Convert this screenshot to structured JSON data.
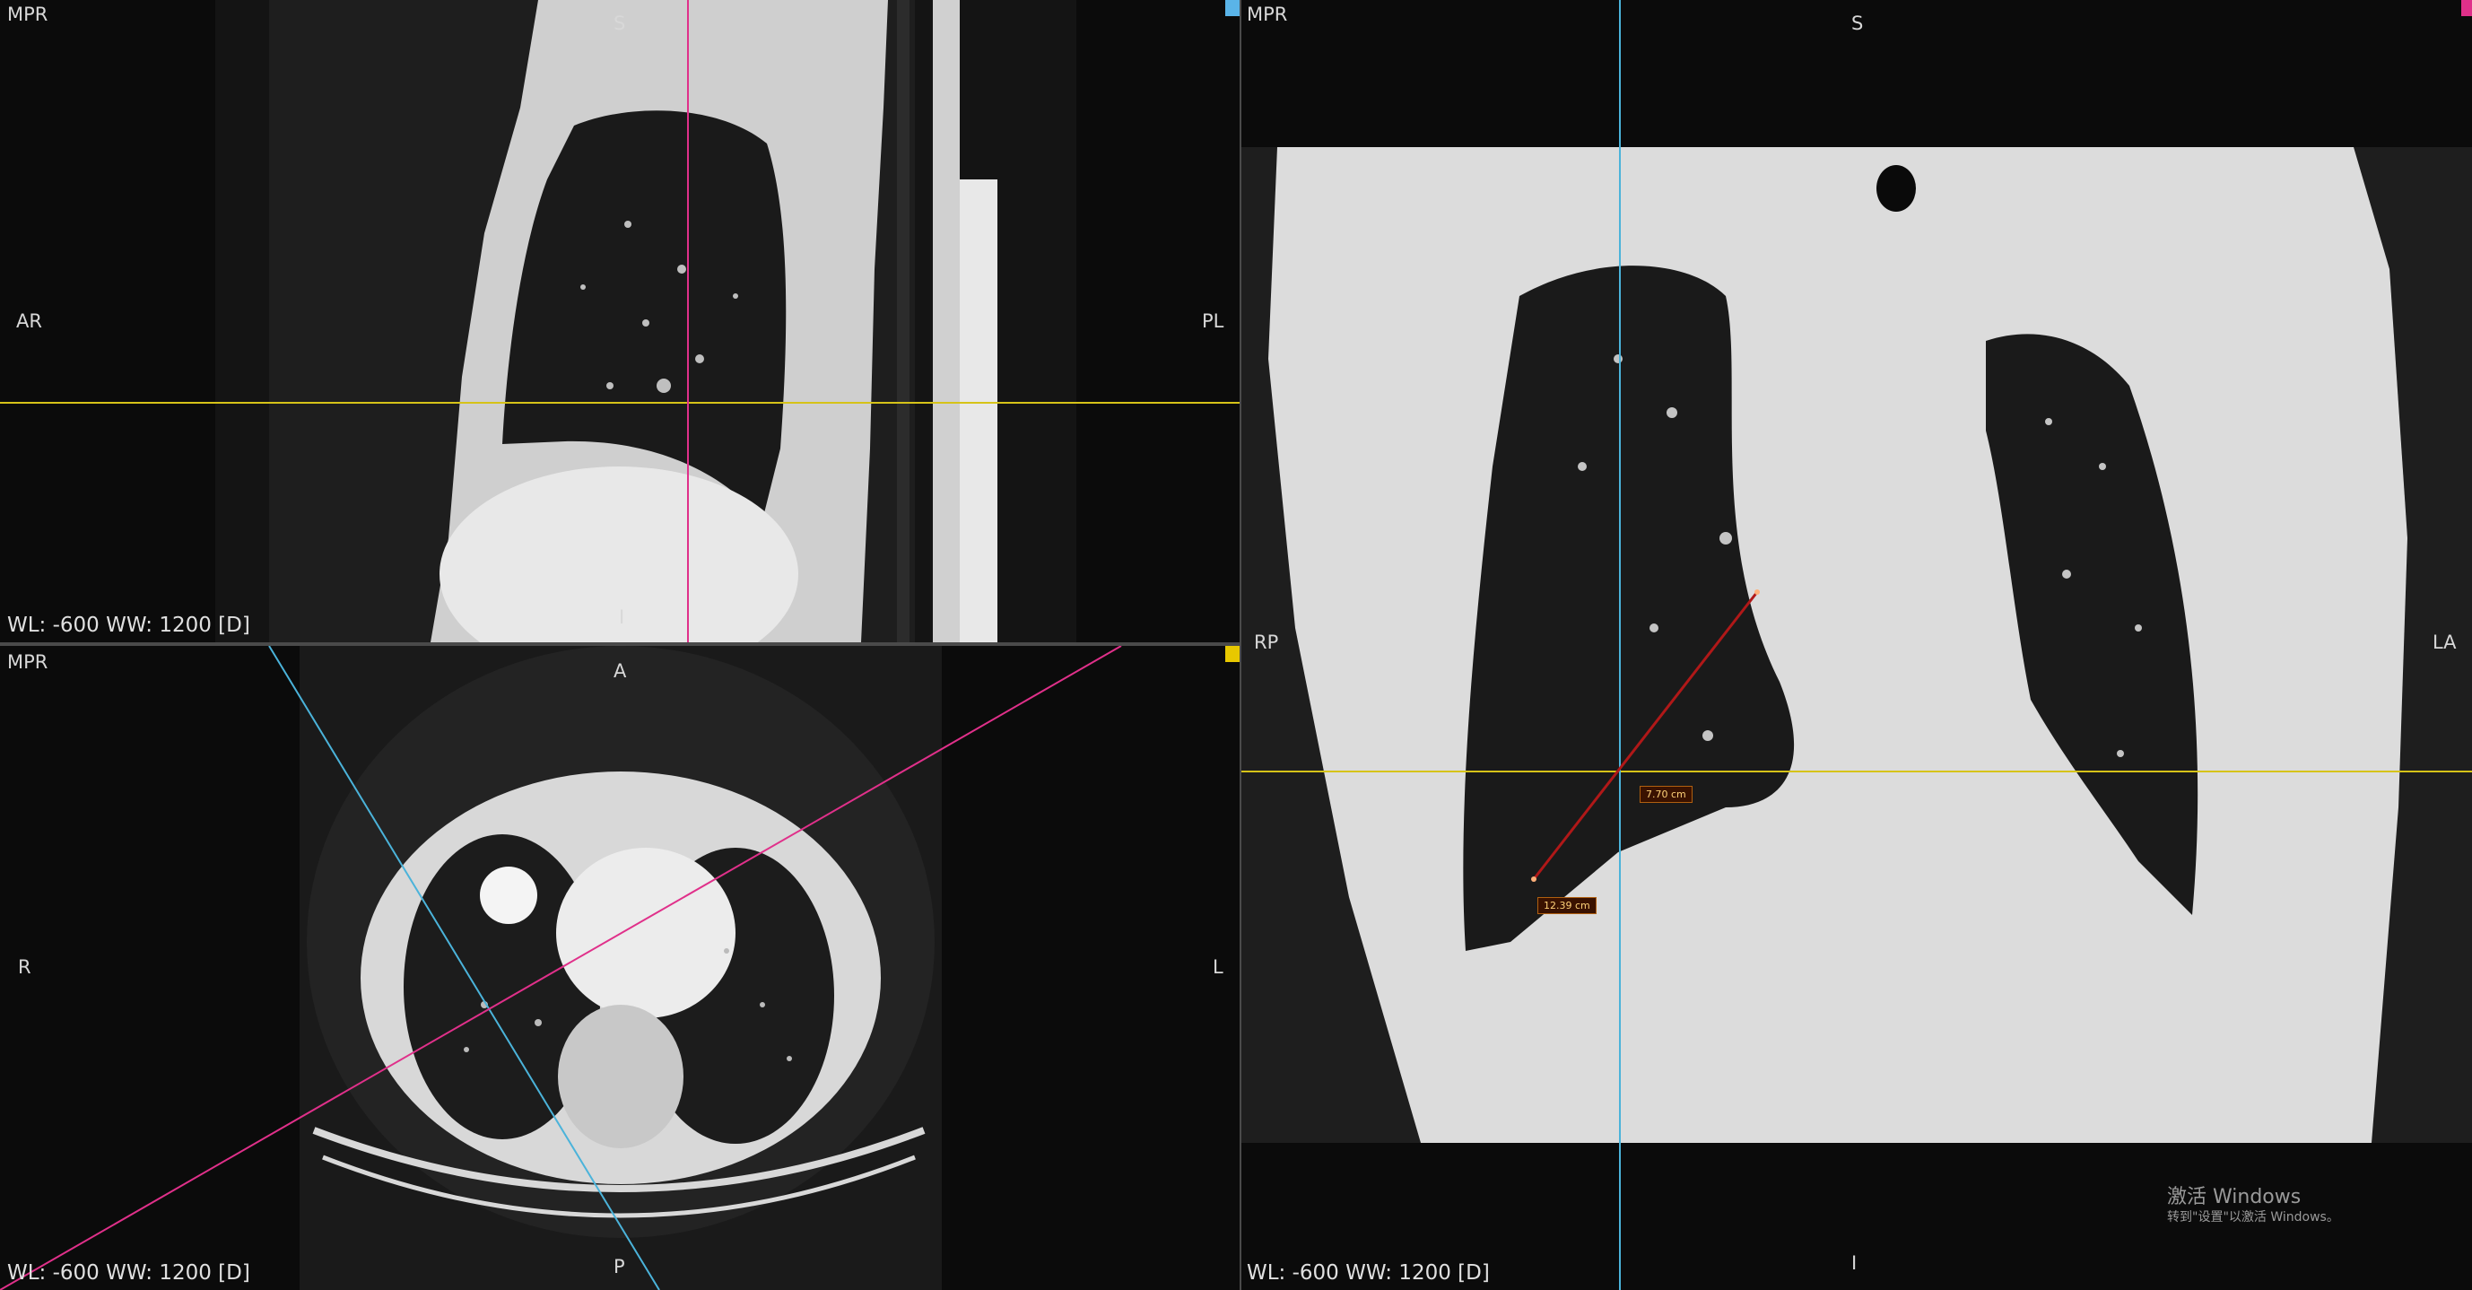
{
  "colors": {
    "sagittal_marker": "#5ab4e8",
    "axial_marker": "#e8c800",
    "coronal_marker": "#e0308a",
    "line_yellow": "#d6c318",
    "line_magenta": "#e0308a",
    "line_cyan": "#4bb3da",
    "measure_red": "#b01818"
  },
  "viewports": {
    "sagittal": {
      "mode": "MPR",
      "top": "S",
      "bottom": "I",
      "left": "AR",
      "right": "PL",
      "window": "WL: -600 WW: 1200 [D]",
      "marker_color": "#5ab4e8"
    },
    "axial": {
      "mode": "MPR",
      "top": "A",
      "bottom": "P",
      "left": "R",
      "right": "L",
      "window": "WL: -600 WW: 1200 [D]",
      "marker_color": "#e8c800"
    },
    "coronal": {
      "mode": "MPR",
      "top": "S",
      "bottom": "I",
      "left": "RP",
      "right": "LA",
      "window": "WL: -600 WW: 1200 [D]",
      "marker_color": "#e0308a",
      "measurements": [
        {
          "value": "7.70 cm"
        },
        {
          "value": "12.39 cm"
        }
      ]
    }
  },
  "watermark": {
    "title": "激活 Windows",
    "subtitle": "转到\"设置\"以激活 Windows。"
  }
}
